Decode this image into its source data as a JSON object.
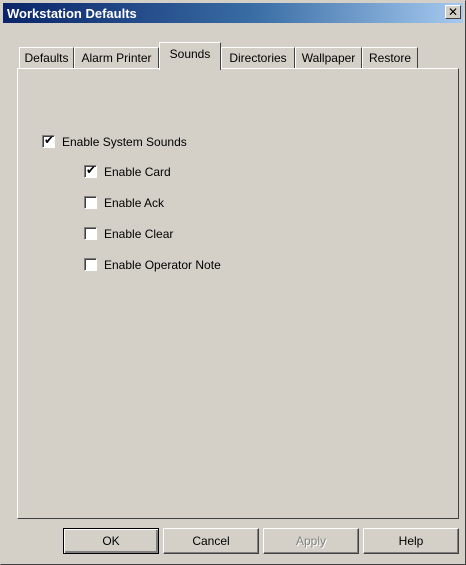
{
  "window": {
    "title": "Workstation Defaults",
    "close_glyph": "✕"
  },
  "tabs": [
    {
      "label": "Defaults",
      "active": false
    },
    {
      "label": "Alarm Printer",
      "active": false
    },
    {
      "label": "Sounds",
      "active": true
    },
    {
      "label": "Directories",
      "active": false
    },
    {
      "label": "Wallpaper",
      "active": false
    },
    {
      "label": "Restore",
      "active": false
    }
  ],
  "sounds": {
    "enable_system_sounds": {
      "label": "Enable System Sounds",
      "checked": true
    },
    "options": [
      {
        "label": "Enable Card",
        "checked": true
      },
      {
        "label": "Enable Ack",
        "checked": false
      },
      {
        "label": "Enable Clear",
        "checked": false
      },
      {
        "label": "Enable Operator Note",
        "checked": false
      }
    ]
  },
  "buttons": {
    "ok": {
      "label": "OK",
      "enabled": true
    },
    "cancel": {
      "label": "Cancel",
      "enabled": true
    },
    "apply": {
      "label": "Apply",
      "enabled": false
    },
    "help": {
      "label": "Help",
      "enabled": true
    }
  },
  "colors": {
    "face": "#d4d0c8",
    "title_start": "#0a246a",
    "title_end": "#a6caf0"
  }
}
